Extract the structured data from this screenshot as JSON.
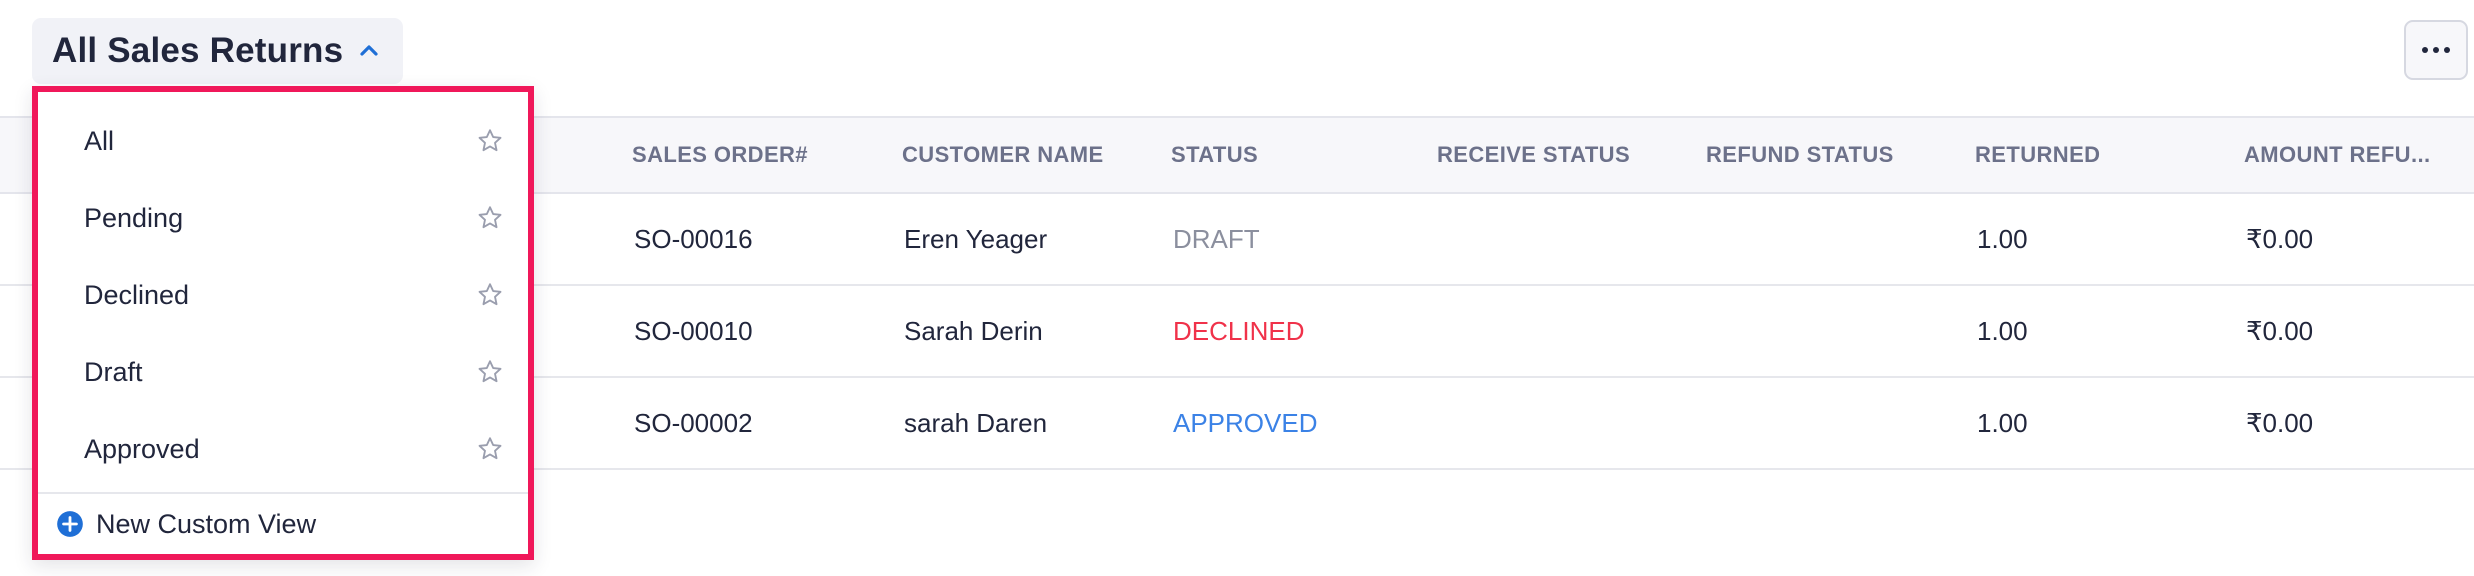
{
  "header": {
    "view_title": "All Sales Returns",
    "chevron_icon": "chevron-up-icon",
    "more_icon": "more-horizontal-icon"
  },
  "table": {
    "columns": [
      "SALES ORDER#",
      "CUSTOMER NAME",
      "STATUS",
      "RECEIVE STATUS",
      "REFUND STATUS",
      "RETURNED",
      "AMOUNT REFU..."
    ],
    "rows": [
      {
        "sales_order": "SO-00016",
        "customer": "Eren Yeager",
        "status": "DRAFT",
        "receive_status": "",
        "refund_status": "",
        "returned": "1.00",
        "amount_refunded": "₹0.00"
      },
      {
        "sales_order": "SO-00010",
        "customer": "Sarah Derin",
        "status": "DECLINED",
        "receive_status": "",
        "refund_status": "",
        "returned": "1.00",
        "amount_refunded": "₹0.00"
      },
      {
        "sales_order": "SO-00002",
        "customer": "sarah Daren",
        "status": "APPROVED",
        "receive_status": "",
        "refund_status": "",
        "returned": "1.00",
        "amount_refunded": "₹0.00"
      }
    ]
  },
  "dropdown": {
    "items": [
      {
        "label": "All",
        "icon": "star-outline-icon"
      },
      {
        "label": "Pending",
        "icon": "star-outline-icon"
      },
      {
        "label": "Declined",
        "icon": "star-outline-icon"
      },
      {
        "label": "Draft",
        "icon": "star-outline-icon"
      },
      {
        "label": "Approved",
        "icon": "star-outline-icon"
      }
    ],
    "new_view_label": "New Custom View",
    "new_view_icon": "plus-circle-icon"
  },
  "colors": {
    "accent": "#1f6fd6",
    "highlight_border": "#f0185a",
    "status_draft": "#8b8f9e",
    "status_declined": "#f0324a",
    "status_approved": "#3b82e6",
    "header_text": "#6c718a"
  }
}
